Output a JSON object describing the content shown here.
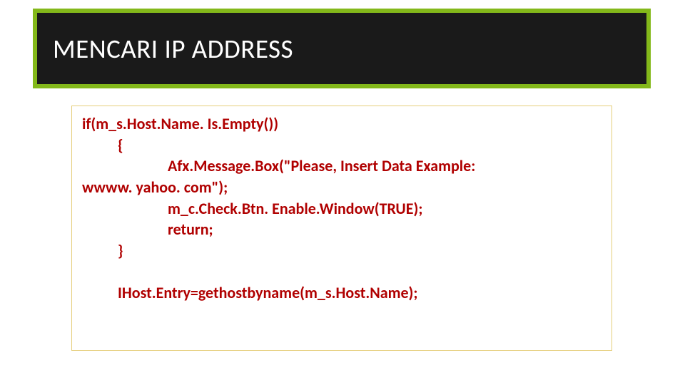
{
  "title": "MENCARI IP ADDRESS",
  "code": {
    "l1": "if(m_s.Host.Name. Is.Empty())",
    "l2": "{",
    "l3a": "Afx.Message.Box(\"Please, Insert Data Example:",
    "l3b": "wwww. yahoo. com\");",
    "l4": "m_c.Check.Btn. Enable.Window(TRUE);",
    "l5": "return;",
    "l6": "}",
    "l7": "IHost.Entry=gethostbyname(m_s.Host.Name);"
  }
}
